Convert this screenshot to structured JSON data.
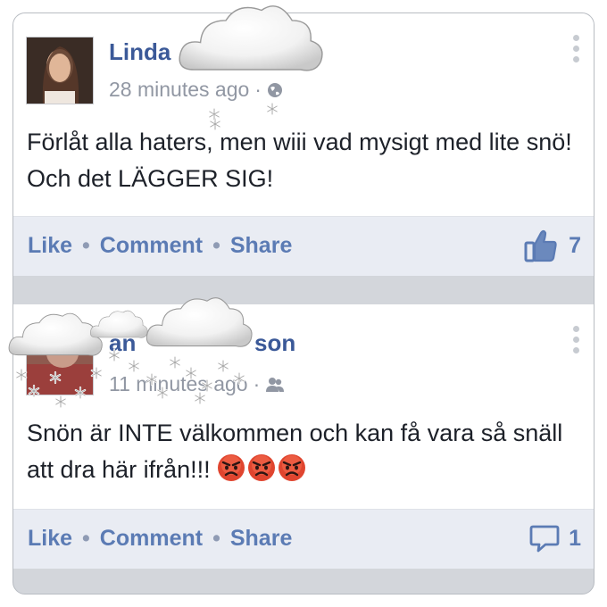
{
  "posts": [
    {
      "author": "Linda",
      "time": "28 minutes ago",
      "separator": "·",
      "privacy_icon": "globe-icon",
      "text": "Förlåt alla haters, men wiii vad mysigt med lite snö! Och det LÄGGER SIG!",
      "actions": {
        "like": "Like",
        "comment": "Comment",
        "share": "Share",
        "dot": "•"
      },
      "count_icon": "thumbs-up-icon",
      "count": "7"
    },
    {
      "author_fragment_1": "an",
      "author_fragment_2": "son",
      "time": "11 minutes ago",
      "separator": "·",
      "privacy_icon": "friends-icon",
      "text": "Snön är INTE välkommen och kan få vara så snäll att dra här ifrån!!!",
      "emoji": [
        "angry-face-icon",
        "angry-face-icon",
        "angry-face-icon"
      ],
      "actions": {
        "like": "Like",
        "comment": "Comment",
        "share": "Share",
        "dot": "•"
      },
      "count_icon": "comment-bubble-icon",
      "count": "1"
    }
  ],
  "colors": {
    "link": "#3b5998",
    "action": "#5b7bb4",
    "meta": "#9197a3",
    "action_bar": "#e9ecf3",
    "feed_bg": "#d3d6db"
  },
  "decorations": [
    "cloud-icon",
    "snowflake-icon"
  ]
}
